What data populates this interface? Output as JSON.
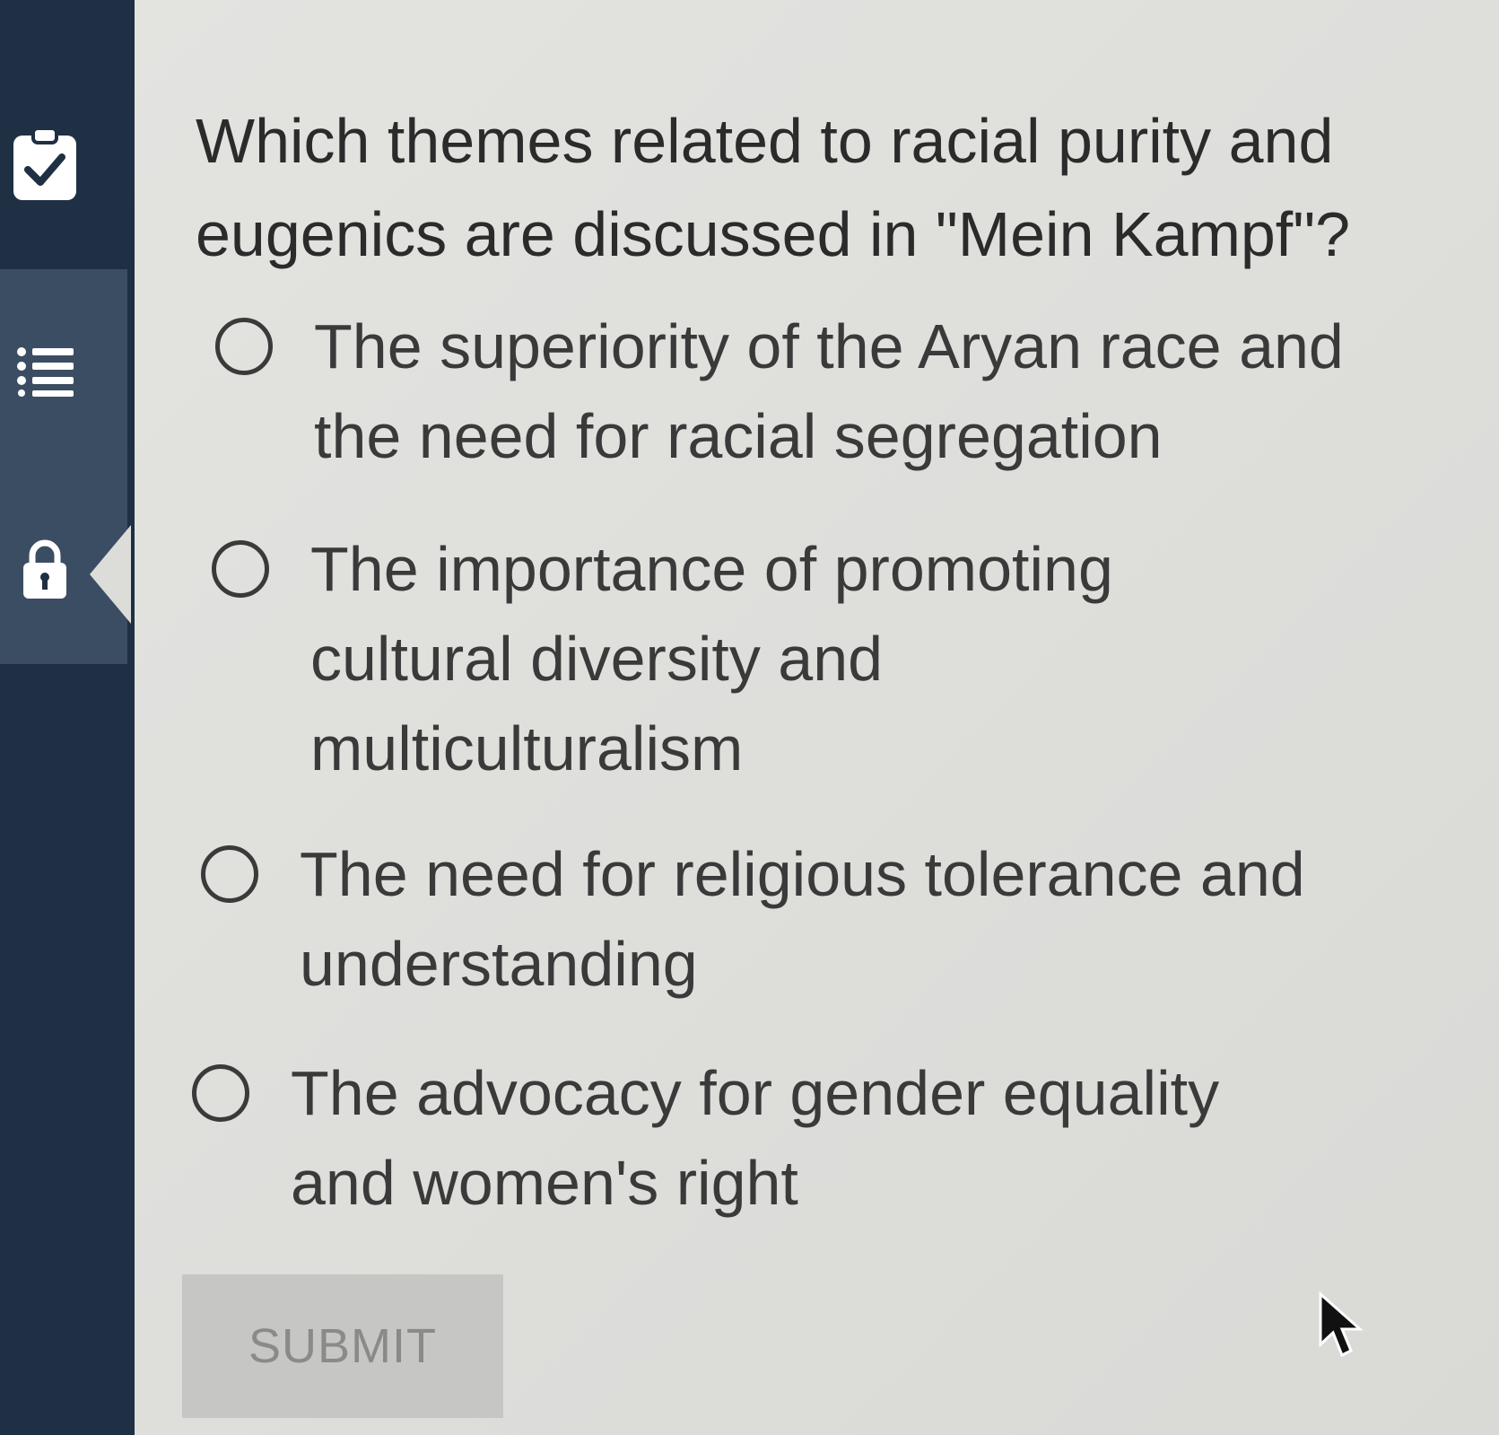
{
  "sidebar": {
    "items": [
      {
        "icon": "clipboard-check-icon"
      },
      {
        "icon": "list-icon"
      },
      {
        "icon": "lock-icon"
      }
    ]
  },
  "question": {
    "text": "Which themes related to racial purity and eugenics are discussed in \"Mein Kampf\"?"
  },
  "options": [
    {
      "label": "The superiority of the Aryan race and the need for racial segregation"
    },
    {
      "label": "The importance of promoting cultural diversity and multiculturalism"
    },
    {
      "label": "The need for religious tolerance and understanding"
    },
    {
      "label": "The advocacy for gender equality and women's right"
    }
  ],
  "submit": {
    "label": "SUBMIT"
  },
  "colors": {
    "sidebar": "#1f3044",
    "sidebar_active": "#3b4d62",
    "background": "#dcdcd9",
    "text": "#2b2b2b",
    "submit_bg": "#c6c6c4",
    "submit_text": "#8a8a88"
  }
}
